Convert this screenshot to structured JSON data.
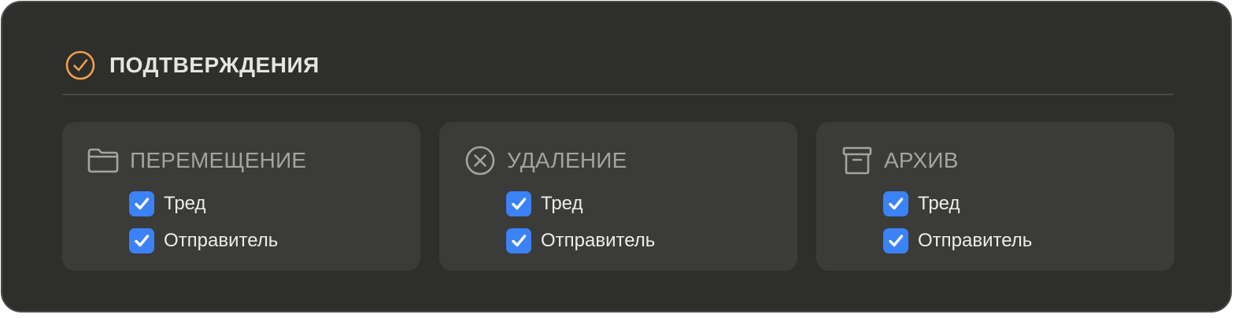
{
  "header": {
    "title": "ПОДТВЕРЖДЕНИЯ",
    "icon": "check-circle-icon"
  },
  "colors": {
    "panel_bg": "#2e2e2c",
    "card_bg": "#3b3b39",
    "accent": "#f0a14a",
    "checkbox": "#3b82f6"
  },
  "groups": [
    {
      "label": "ПЕРЕМЕЩЕНИЕ",
      "icon": "folder-icon",
      "options": [
        {
          "label": "Тред",
          "checked": true
        },
        {
          "label": "Отправитель",
          "checked": true
        }
      ]
    },
    {
      "label": "УДАЛЕНИЕ",
      "icon": "x-circle-icon",
      "options": [
        {
          "label": "Тред",
          "checked": true
        },
        {
          "label": "Отправитель",
          "checked": true
        }
      ]
    },
    {
      "label": "АРХИВ",
      "icon": "archive-box-icon",
      "options": [
        {
          "label": "Тред",
          "checked": true
        },
        {
          "label": "Отправитель",
          "checked": true
        }
      ]
    }
  ]
}
